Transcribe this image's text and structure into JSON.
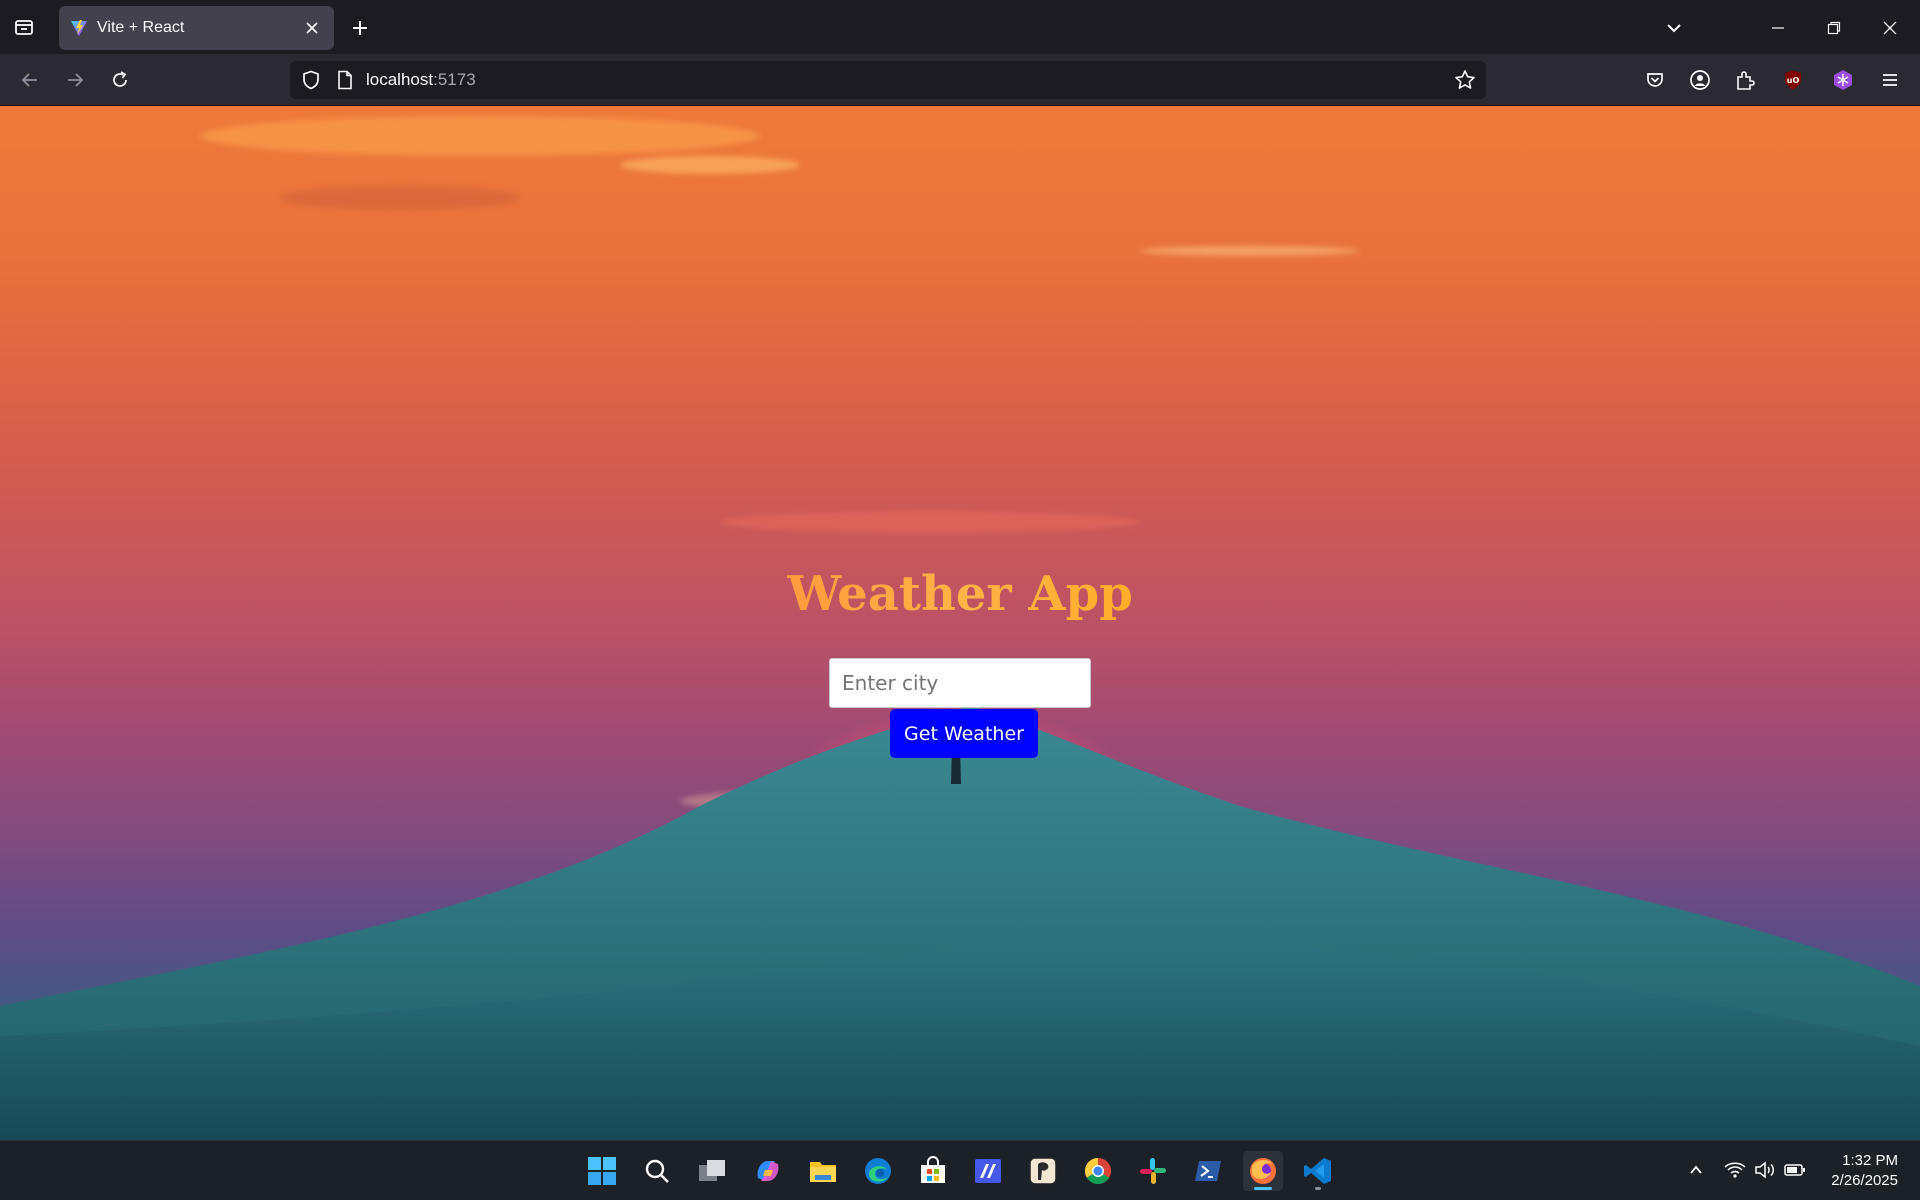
{
  "browser": {
    "tab": {
      "title": "Vite + React"
    },
    "url": {
      "host": "localhost",
      "port": ":5173"
    }
  },
  "app": {
    "title": "Weather App",
    "city_input": {
      "placeholder": "Enter city",
      "value": ""
    },
    "submit_label": "Get Weather"
  },
  "taskbar": {
    "apps": [
      "start-icon",
      "search-icon",
      "task-view-icon",
      "copilot-icon",
      "file-explorer-icon",
      "edge-icon",
      "microsoft-store-icon",
      "vs-app-icon",
      "notion-icon",
      "chrome-icon",
      "slack-icon",
      "powershell-icon",
      "firefox-icon",
      "vscode-icon"
    ],
    "active_app": "firefox-icon",
    "clock": {
      "time": "1:32 PM",
      "date": "2/26/2025"
    }
  },
  "colors": {
    "submit_button": "#0000ff",
    "title_gradient": [
      "#ff9a3c",
      "#ffae2a"
    ]
  }
}
